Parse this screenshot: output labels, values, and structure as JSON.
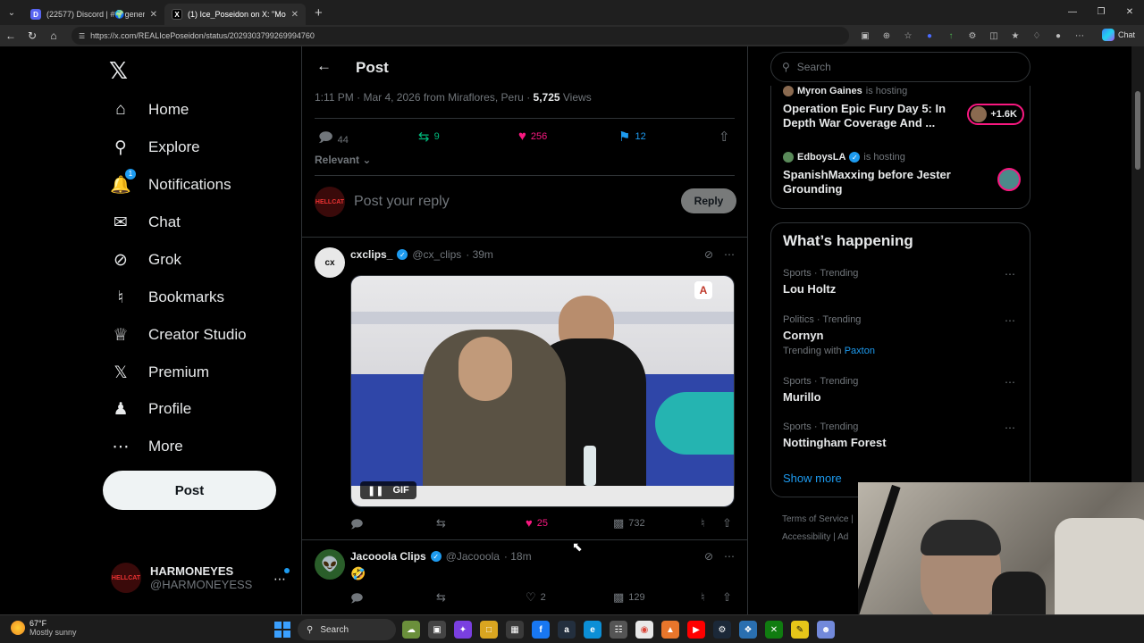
{
  "browser": {
    "tabs": [
      {
        "title": "(22577) Discord | #🌍general | Pu",
        "favicon": "D",
        "active": false
      },
      {
        "title": "(1) Ice_Poseidon on X: \"Mogging P",
        "favicon": "X",
        "active": true
      }
    ],
    "url": "https://x.com/REALIcePoseidon/status/2029303799269994760",
    "chat_label": "Chat"
  },
  "sidebar": {
    "items": [
      {
        "label": "Home",
        "icon": "home-icon"
      },
      {
        "label": "Explore",
        "icon": "search-icon"
      },
      {
        "label": "Notifications",
        "icon": "bell-icon",
        "badge": "1"
      },
      {
        "label": "Chat",
        "icon": "mail-icon"
      },
      {
        "label": "Grok",
        "icon": "grok-icon"
      },
      {
        "label": "Bookmarks",
        "icon": "bookmark-icon"
      },
      {
        "label": "Creator Studio",
        "icon": "creator-icon"
      },
      {
        "label": "Premium",
        "icon": "x-icon"
      },
      {
        "label": "Profile",
        "icon": "person-icon"
      },
      {
        "label": "More",
        "icon": "more-circle-icon"
      }
    ],
    "post_label": "Post",
    "account": {
      "name": "HARMONEYES",
      "handle": "@HARMONEYESS",
      "avatar_text": "HELLCAT"
    }
  },
  "post": {
    "header_title": "Post",
    "meta_prefix": "1:11 PM · Mar 4, 2026 from Miraflores, Peru · ",
    "views_count": "5,725",
    "views_label": " Views",
    "stats": {
      "replies": "44",
      "reposts": "9",
      "likes": "256",
      "bookmarks": "12"
    },
    "sort_label": "Relevant",
    "reply_placeholder": "Post your reply",
    "reply_button": "Reply"
  },
  "replies": [
    {
      "name": "cxclips_",
      "handle": "@cx_clips",
      "time": "· 39m",
      "avatar_text": "cx",
      "media_badge": "GIF",
      "actions": {
        "replies": "",
        "reposts": "",
        "likes": "25",
        "views": "732"
      }
    },
    {
      "name": "Jacooola Clips",
      "handle": "@Jacooola",
      "time": "· 18m",
      "text": "🤣",
      "actions": {
        "replies": "",
        "reposts": "",
        "likes": "2",
        "views": "129"
      }
    }
  ],
  "right": {
    "search_placeholder": "Search",
    "spaces": [
      {
        "host": "Myron Gaines",
        "host_suffix": "is hosting",
        "title": "Operation Epic Fury Day 5: In Depth War Coverage And ...",
        "listeners": "+1.6K"
      },
      {
        "host": "EdboysLA",
        "host_suffix": "is hosting",
        "title": "SpanishMaxxing before Jester Grounding"
      }
    ],
    "happening_title": "What’s happening",
    "trends": [
      {
        "category": "Sports · Trending",
        "name": "Lou Holtz"
      },
      {
        "category": "Politics · Trending",
        "name": "Cornyn",
        "with_prefix": "Trending with",
        "with_link": "Paxton"
      },
      {
        "category": "Sports · Trending",
        "name": "Murillo"
      },
      {
        "category": "Sports · Trending",
        "name": "Nottingham Forest"
      }
    ],
    "show_more": "Show more",
    "footer": {
      "terms": "Terms of Service",
      "sep": "|",
      "accessibility": "Accessibility",
      "ads": "Ad"
    }
  },
  "taskbar": {
    "temperature": "67°F",
    "weather": "Mostly sunny",
    "search_label": "Search"
  },
  "colors": {
    "accent": "#1d9bf0",
    "like": "#f91880",
    "repost": "#00ba7c",
    "background": "#000000"
  }
}
